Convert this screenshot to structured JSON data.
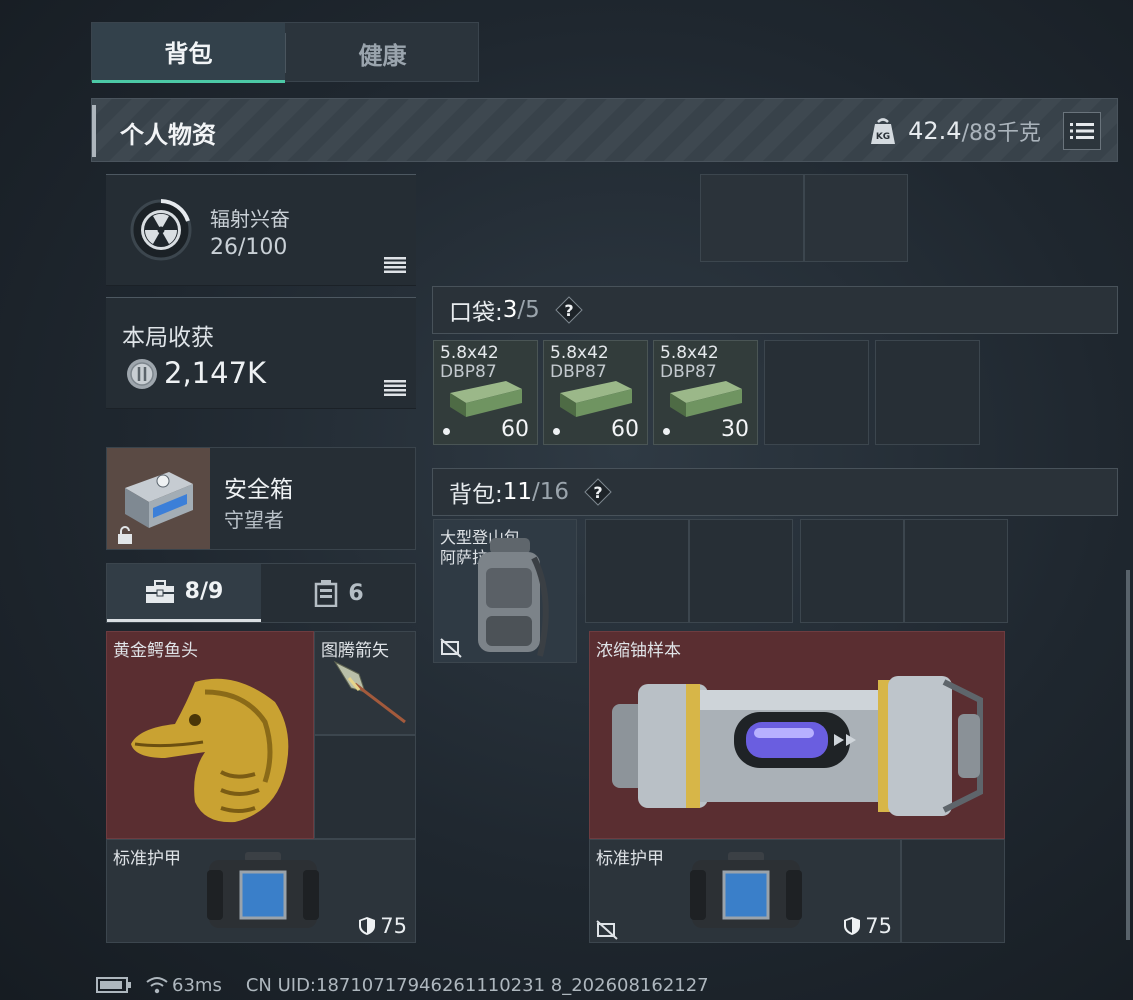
{
  "tabs": [
    {
      "label": "背包"
    },
    {
      "label": "健康"
    }
  ],
  "header": {
    "title": "个人物资",
    "weight_current": "42.4",
    "weight_capacity": "/88千克"
  },
  "radiation": {
    "name": "辐射兴奋",
    "value": "26/100",
    "level": 0.26
  },
  "loot": {
    "label": "本局收获",
    "value": "2,147K"
  },
  "safe_box": {
    "name": "安全箱",
    "subtitle": "守望者"
  },
  "sub_tabs": [
    {
      "label": "8/9"
    },
    {
      "label": "6"
    }
  ],
  "left_items": [
    {
      "name": "黄金鳄鱼头"
    },
    {
      "name": "图腾箭矢"
    },
    {
      "name": "标准护甲",
      "durability": "75"
    }
  ],
  "pockets": {
    "label": "口袋: ",
    "current": "3",
    "total": "/5",
    "help": "?"
  },
  "ammo_items": [
    {
      "line1": "5.8x42",
      "line2": "DBP87",
      "count": "60"
    },
    {
      "line1": "5.8x42",
      "line2": "DBP87",
      "count": "60"
    },
    {
      "line1": "5.8x42",
      "line2": "DBP87",
      "count": "30"
    }
  ],
  "backpack": {
    "label": "背包: ",
    "current": "11",
    "total": "/16",
    "help": "?"
  },
  "backpack_item": {
    "line1": "大型登山包",
    "line2": "阿萨拉"
  },
  "right_items": [
    {
      "name": "浓缩铀样本"
    },
    {
      "name": "标准护甲",
      "durability": "75"
    }
  ],
  "status": {
    "ping": "63ms",
    "uid": "CN UID:18710717946261110231 8_202608162127"
  }
}
